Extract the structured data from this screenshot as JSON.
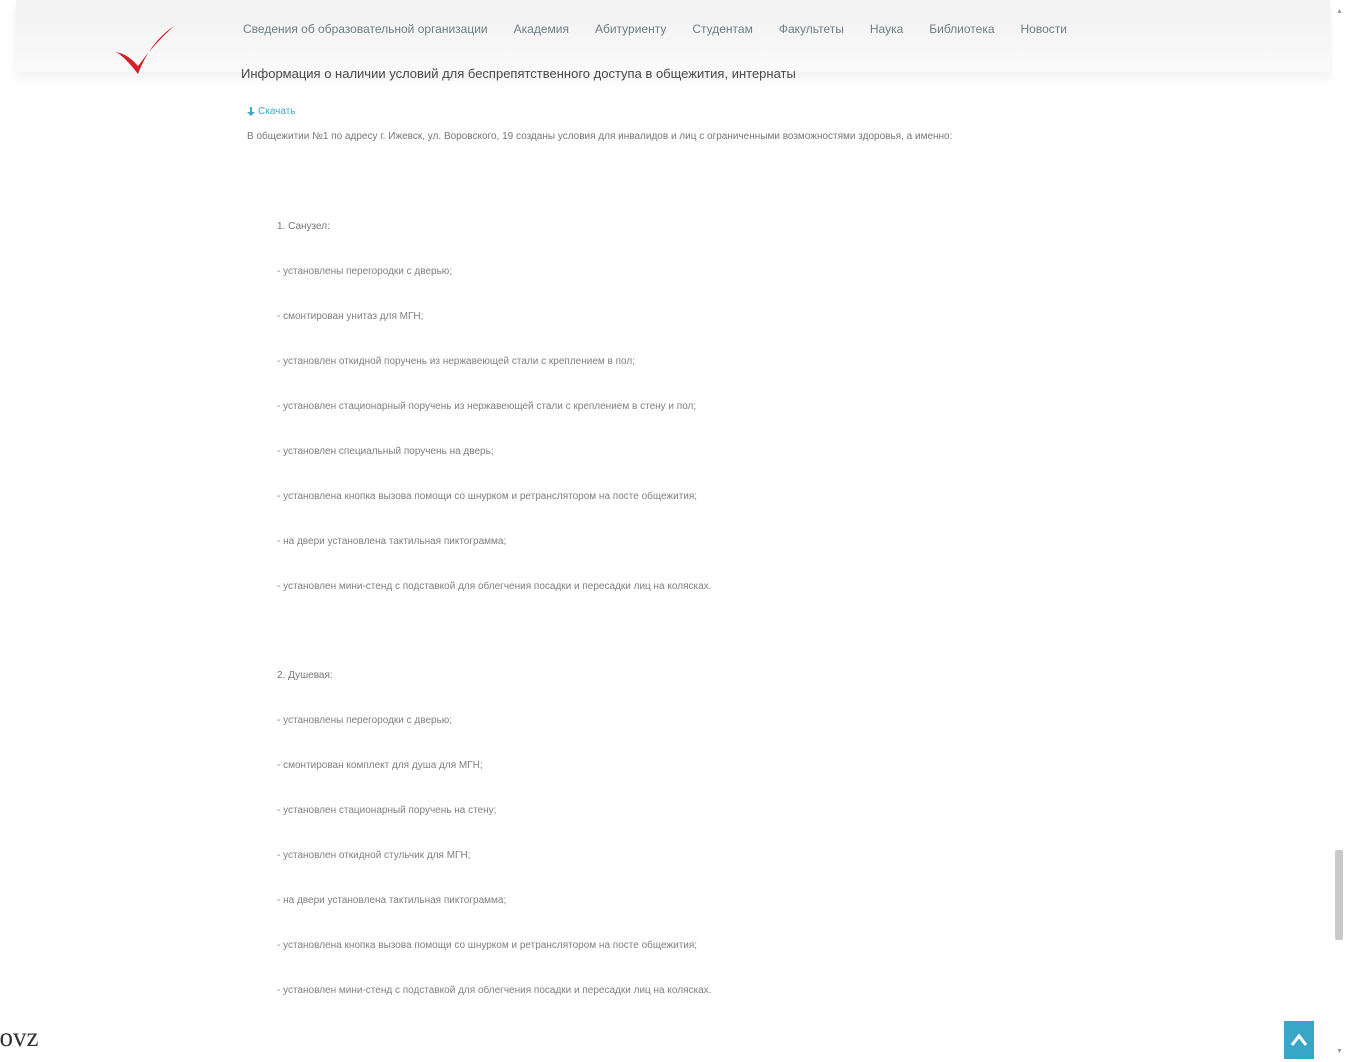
{
  "nav": {
    "items": [
      "Сведения об образовательной организации",
      "Академия",
      "Абитуриенту",
      "Студентам",
      "Факультеты",
      "Наука",
      "Библиотека",
      "Новости"
    ]
  },
  "page": {
    "title": "Информация о наличии условий для беспрепятственного доступа в общежития, интернаты",
    "download_label": "Скачать",
    "intro": "В общежитии №1 по адресу г. Ижевск, ул. Воровского, 19 созданы условия для инвалидов и лиц с ограниченными возможностями здоровья, а именно:"
  },
  "sections": [
    {
      "heading": "1. Санузел:",
      "items": [
        "- установлены перегородки с дверью;",
        "- смонтирован унитаз для МГН;",
        "- установлен откидной поручень из нержавеющей стали с креплением в пол;",
        "- установлен стационарный поручень из нержавеющей стали с креплением в стену и пол;",
        "- установлен специальный поручень на дверь;",
        "- установлена кнопка вызова помощи со шнурком и ретранслятором на посте общежития;",
        "- на двери установлена тактильная пиктограмма;",
        "- установлен мини-стенд с подставкой для облегчения посадки и пересадки лиц на колясках."
      ]
    },
    {
      "heading": "2. Душевая:",
      "items": [
        "- установлены перегородки с дверью;",
        "- смонтирован комплект для душа для МГН;",
        "- установлен стационарный поручень на стену;",
        "- установлен откидной стульчик для МГН;",
        "- на двери установлена тактильная пиктограмма;",
        "- установлена кнопка вызова помощи со шнурком и ретранслятором на посте общежития;",
        "- установлен мини-стенд с подставкой для облегчения посадки и пересадки лиц на колясках."
      ]
    }
  ],
  "corner_text": "/ovz",
  "colors": {
    "nav_text": "#6b7e86",
    "link": "#3fa9c4",
    "accent_button": "#3aa6c7",
    "checkmark": "#d0202a"
  }
}
